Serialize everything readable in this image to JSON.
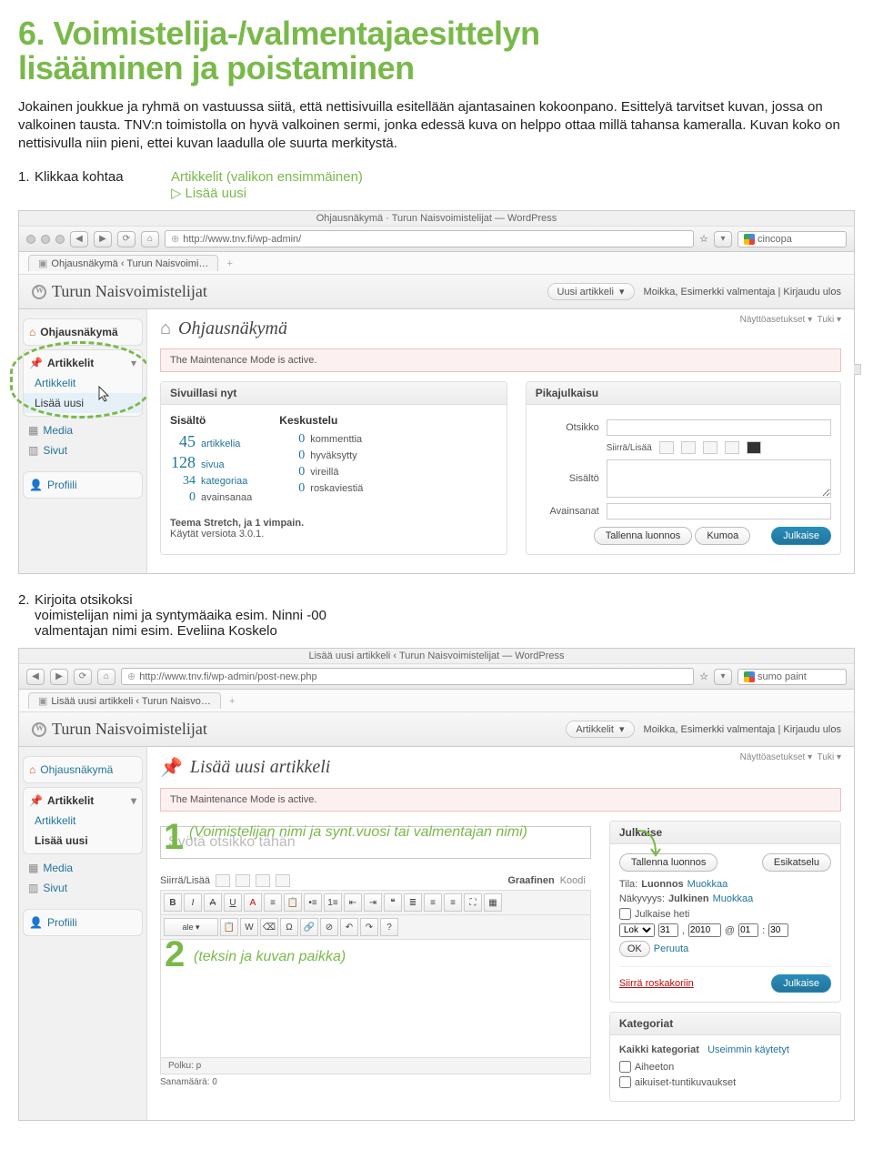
{
  "heading_line1": "6. Voimistelija-/valmentajaesittelyn",
  "heading_line2": "lisääminen ja poistaminen",
  "intro": "Jokainen joukkue ja ryhmä on vastuussa siitä, että nettisivuilla esitellään ajantasainen kokoonpano. Esittelyä tarvitset kuvan, jossa on valkoinen tausta. TNV:n toimistolla on hyvä valkoinen sermi, jonka edessä kuva on helppo ottaa millä tahansa kameralla. Kuvan koko on nettisivulla niin pieni, ettei kuvan laadulla ole suurta merkitystä.",
  "step1": {
    "num": "1.",
    "label": "Klikkaa kohtaa",
    "line1": "Artikkelit (valikon ensimmäinen)",
    "tri": "▷",
    "line2": "Lisää uusi"
  },
  "shot1": {
    "win_title": "Ohjausnäkymä · Turun Naisvoimistelijat — WordPress",
    "url": "http://www.tnv.fi/wp-admin/",
    "star": "☆",
    "search": "cincopa",
    "tab": "Ohjausnäkymä ‹ Turun Naisvoimi…",
    "site": "Turun Naisvoimistelijat",
    "new_btn": "Uusi artikkeli",
    "user": "Moikka, Esimerkki valmentaja | Kirjaudu ulos",
    "screen_opt": "Näyttöasetukset ▾",
    "help": "Tuki ▾",
    "sidebar": {
      "dash": "Ohjausnäkymä",
      "artikkelit": "Artikkelit",
      "artikkelit_sub": "Artikkelit",
      "lisaa": "Lisää uusi",
      "media": "Media",
      "sivut": "Sivut",
      "profiili": "Profiili"
    },
    "main_h": "Ohjausnäkymä",
    "notice": "The Maintenance Mode is active.",
    "rightnow_h": "Sivuillasi nyt",
    "content_h": "Sisältö",
    "discussion_h": "Keskustelu",
    "stats": {
      "articles_n": "45",
      "articles": "artikkelia",
      "pages_n": "128",
      "pages": "sivua",
      "cats_n": "34",
      "cats": "kategoriaa",
      "tags_n": "0",
      "tags": "avainsanaa",
      "comments_n": "0",
      "comments": "kommenttia",
      "approved_n": "0",
      "approved": "hyväksytty",
      "pending_n": "0",
      "pending": "vireillä",
      "spam_n": "0",
      "spam": "roskaviestiä"
    },
    "theme": "Teema Stretch, ja 1 vimpain.",
    "version": "Käytät versiota 3.0.1.",
    "qp_h": "Pikajulkaisu",
    "qp_title": "Otsikko",
    "qp_upload": "Siirrä/Lisää",
    "qp_content": "Sisältö",
    "qp_tags": "Avainsanat",
    "qp_save": "Tallenna luonnos",
    "qp_reset": "Kumoa",
    "qp_publish": "Julkaise"
  },
  "step2": {
    "num": "2.",
    "text": "Kirjoita otsikoksi",
    "l2": "voimistelijan nimi ja syntymäaika esim. Ninni -00",
    "l3": "valmentajan nimi esim. Eveliina Koskelo"
  },
  "shot2": {
    "win_title": "Lisää uusi artikkeli ‹ Turun Naisvoimistelijat — WordPress",
    "url": "http://www.tnv.fi/wp-admin/post-new.php",
    "search": "sumo paint",
    "tab": "Lisää uusi artikkeli ‹ Turun Naisvo…",
    "site": "Turun Naisvoimistelijat",
    "new_btn": "Artikkelit",
    "user": "Moikka, Esimerkki valmentaja | Kirjaudu ulos",
    "screen_opt": "Näyttöasetukset ▾",
    "help": "Tuki ▾",
    "sidebar": {
      "dash": "Ohjausnäkymä",
      "artikkelit": "Artikkelit",
      "artikkelit_sub": "Artikkelit",
      "lisaa": "Lisää uusi",
      "media": "Media",
      "sivut": "Sivut",
      "profiili": "Profiili"
    },
    "main_h": "Lisää uusi artikkeli",
    "notice": "The Maintenance Mode is active.",
    "title_placeholder": "Syötä otsikko tähän",
    "upload_label": "Siirrä/Lisää",
    "tab_visual": "Graafinen",
    "tab_html": "Koodi",
    "path": "Polku: p",
    "words": "Sanamäärä: 0",
    "annot_a": "1",
    "annot_a_text": "(Voimistelijan nimi ja synt.vuosi tai valmentajan nimi)",
    "annot_b": "2",
    "annot_b_text": "(teksin ja kuvan paikka)",
    "publish_h": "Julkaise",
    "save_draft": "Tallenna luonnos",
    "preview": "Esikatselu",
    "status_l": "Tila:",
    "status_v": "Luonnos",
    "status_edit": "Muokkaa",
    "vis_l": "Näkyvyys:",
    "vis_v": "Julkinen",
    "vis_edit": "Muokkaa",
    "pub_immediate": "Julkaise heti",
    "date_month": "Lok",
    "date_day": "31",
    "date_year": "2010",
    "date_at": "@",
    "date_h": "01",
    "date_m": "30",
    "ok": "OK",
    "cancel": "Peruuta",
    "trash": "Siirrä roskakoriin",
    "publish": "Julkaise",
    "cats_h": "Kategoriat",
    "cats_all": "Kaikki kategoriat",
    "cats_used": "Useimmin käytetyt",
    "cat1": "Aiheeton",
    "cat2": "aikuiset-tuntikuvaukset"
  }
}
